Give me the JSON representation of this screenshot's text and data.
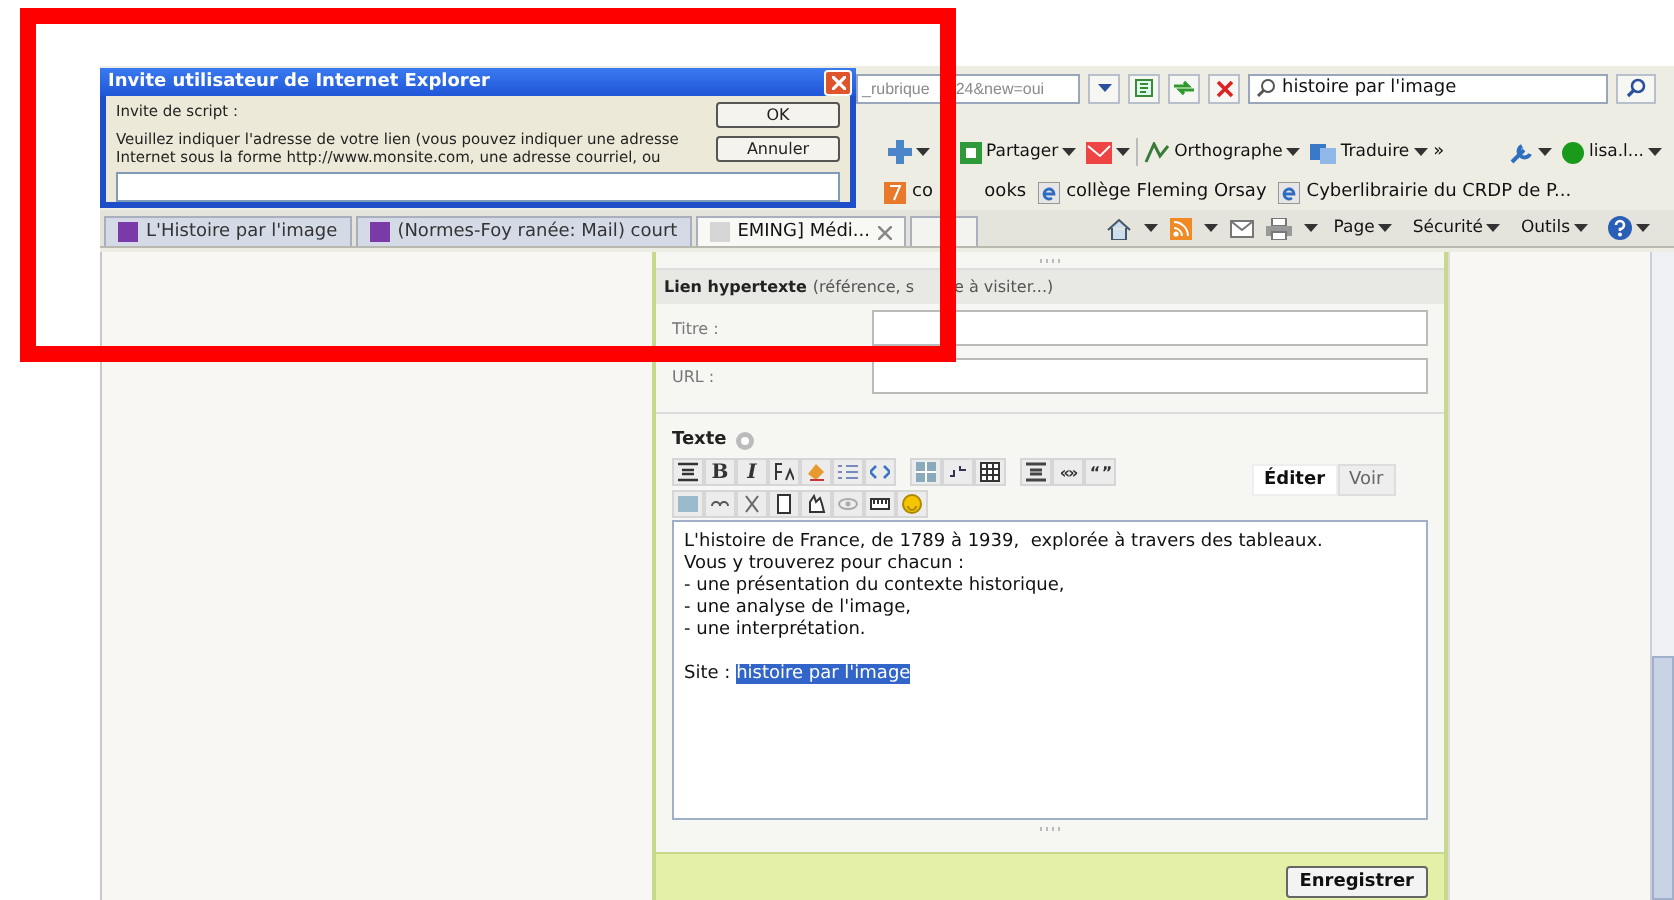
{
  "dialog": {
    "title": "Invite utilisateur de Internet Explorer",
    "prompt_label": "Invite de script :",
    "message": "Veuillez indiquer l'adresse de votre lien (vous pouvez indiquer une adresse Internet sous la forme http://www.monsite.com, une adresse courriel, ou",
    "buttons": [
      "OK",
      "Annuler"
    ]
  },
  "address_bar": {
    "text_1": "_rubrique",
    "text_2": "24&new=oui"
  },
  "search": {
    "value": "histoire par l'image"
  },
  "toolbar": {
    "menus": [
      "Partager",
      "Orthographe",
      "Traduire"
    ],
    "more": "»",
    "user": "lisa.l..."
  },
  "favorites": [
    "co  ooks",
    "collège Fleming Orsay",
    "Cyberlibrairie du CRDP de P..."
  ],
  "tabs": [
    {
      "label": "L'Histoire par l'image",
      "selected": false
    },
    {
      "label": "(Normes-Foy ranée: Mail) court",
      "selected": false
    },
    {
      "label": "EMING] Médi...",
      "selected": true
    }
  ],
  "command_bar": [
    "Page",
    "Sécurité",
    "Outils"
  ],
  "form": {
    "link_section": {
      "title": "Lien hypertexte",
      "hint_1": "(référence, s",
      "hint_2": "e à visiter...)",
      "fields": [
        {
          "label": "Titre :"
        },
        {
          "label": "URL :"
        }
      ]
    },
    "text_section": {
      "title": "Texte",
      "format_buttons": [
        "B",
        "I"
      ],
      "quote_buttons": [
        "«»",
        "“ ”"
      ],
      "edit_tabs": [
        {
          "label": "Éditer",
          "selected": true
        },
        {
          "label": "Voir",
          "selected": false
        }
      ],
      "lines": [
        "L'histoire de France, de 1789 à 1939,  explorée à travers des tableaux.",
        "Vous y trouverez pour chacun :",
        "- une présentation du contexte historique,",
        "- une analyse de l'image,",
        "- une interprétation."
      ],
      "site_label": "Site :",
      "site_link": "histoire par l'image"
    },
    "save_button": "Enregistrer"
  }
}
